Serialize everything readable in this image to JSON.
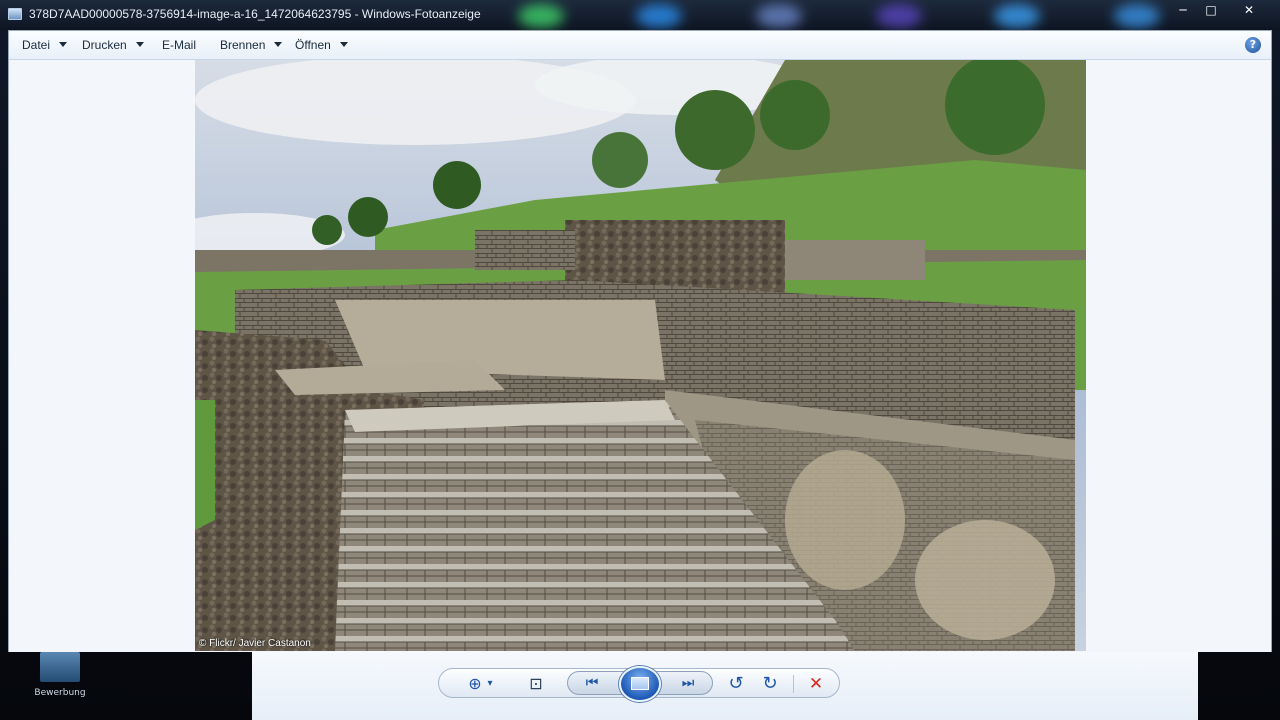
{
  "window": {
    "title": "378D7AAD00000578-3756914-image-a-16_1472064623795 - Windows-Fotoanzeige",
    "controls": {
      "minimize": "─",
      "maximize": "□",
      "close": "✕"
    }
  },
  "menu": {
    "datei": "Datei",
    "drucken": "Drucken",
    "email": "E-Mail",
    "brennen": "Brennen",
    "oeffnen": "Öffnen",
    "help": "?"
  },
  "photo": {
    "credit": "© Flickr/ Javier Castanon",
    "description_icon": "photo-pyramid-stairs"
  },
  "toolbar": {
    "zoom": "⊕",
    "zoom_caret": "▾",
    "fit": "⊡",
    "prev": "⏮",
    "next": "⏭",
    "rotate_left": "↺",
    "rotate_right": "↻",
    "delete": "✕"
  },
  "desktop": {
    "icon_label": "Bewerbung"
  },
  "colors": {
    "accent": "#1e56a8",
    "delete": "#d9281e",
    "titlebar": "#0e1522"
  }
}
